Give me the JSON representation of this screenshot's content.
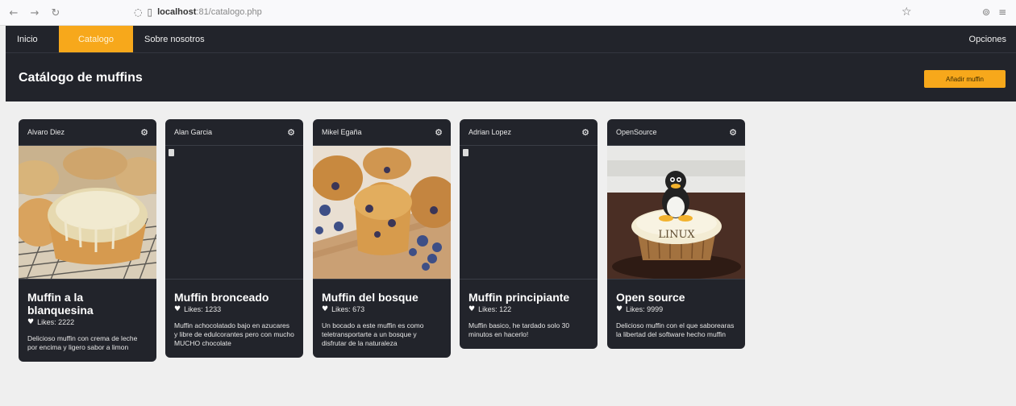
{
  "browser": {
    "host": "localhost",
    "path": ":81/catalogo.php",
    "icons": [
      "back-icon",
      "forward-icon",
      "reload-icon",
      "shield-icon",
      "page-icon",
      "star-icon",
      "extensions-icon",
      "menu-icon"
    ]
  },
  "nav": {
    "items": [
      {
        "label": "Inicio"
      },
      {
        "label": "Catalogo"
      },
      {
        "label": "Sobre nosotros"
      }
    ],
    "options_label": "Opciones",
    "active_color": "#f7a81b",
    "bg_color": "#22242b"
  },
  "header": {
    "title": "Catálogo de muffins",
    "add_button": "Añadir muffin"
  },
  "cards": [
    {
      "author": "Alvaro Diez",
      "title": "Muffin a la blanquesina",
      "likes": "Likes: 2222",
      "description": "Delicioso muffin con crema de leche por encima y ligero sabor a limon",
      "image": "glazed-muffin-photo"
    },
    {
      "author": "Alan Garcia",
      "title": "Muffin bronceado",
      "likes": "Likes: 1233",
      "description": "Muffin achocolatado bajo en azucares y libre de edulcorantes pero con mucho MUCHO chocolate",
      "image": "broken-image"
    },
    {
      "author": "Mikel Egaña",
      "title": "Muffin del bosque",
      "likes": "Likes: 673",
      "description": "Un bocado a este muffin es como teletransportarte a un bosque y disfrutar de la naturaleza",
      "image": "blueberry-muffin-photo"
    },
    {
      "author": "Adrian Lopez",
      "title": "Muffin principiante",
      "likes": "Likes: 122",
      "description": "Muffin basico, he tardado solo 30 minutos en hacerlo!",
      "image": "broken-image"
    },
    {
      "author": "OpenSource",
      "title": "Open source",
      "likes": "Likes: 9999",
      "description": "Delicioso muffin con el que saborearas la libertad del software hecho muffin",
      "image": "linux-cupcake-photo",
      "image_text": "LINUX"
    }
  ]
}
